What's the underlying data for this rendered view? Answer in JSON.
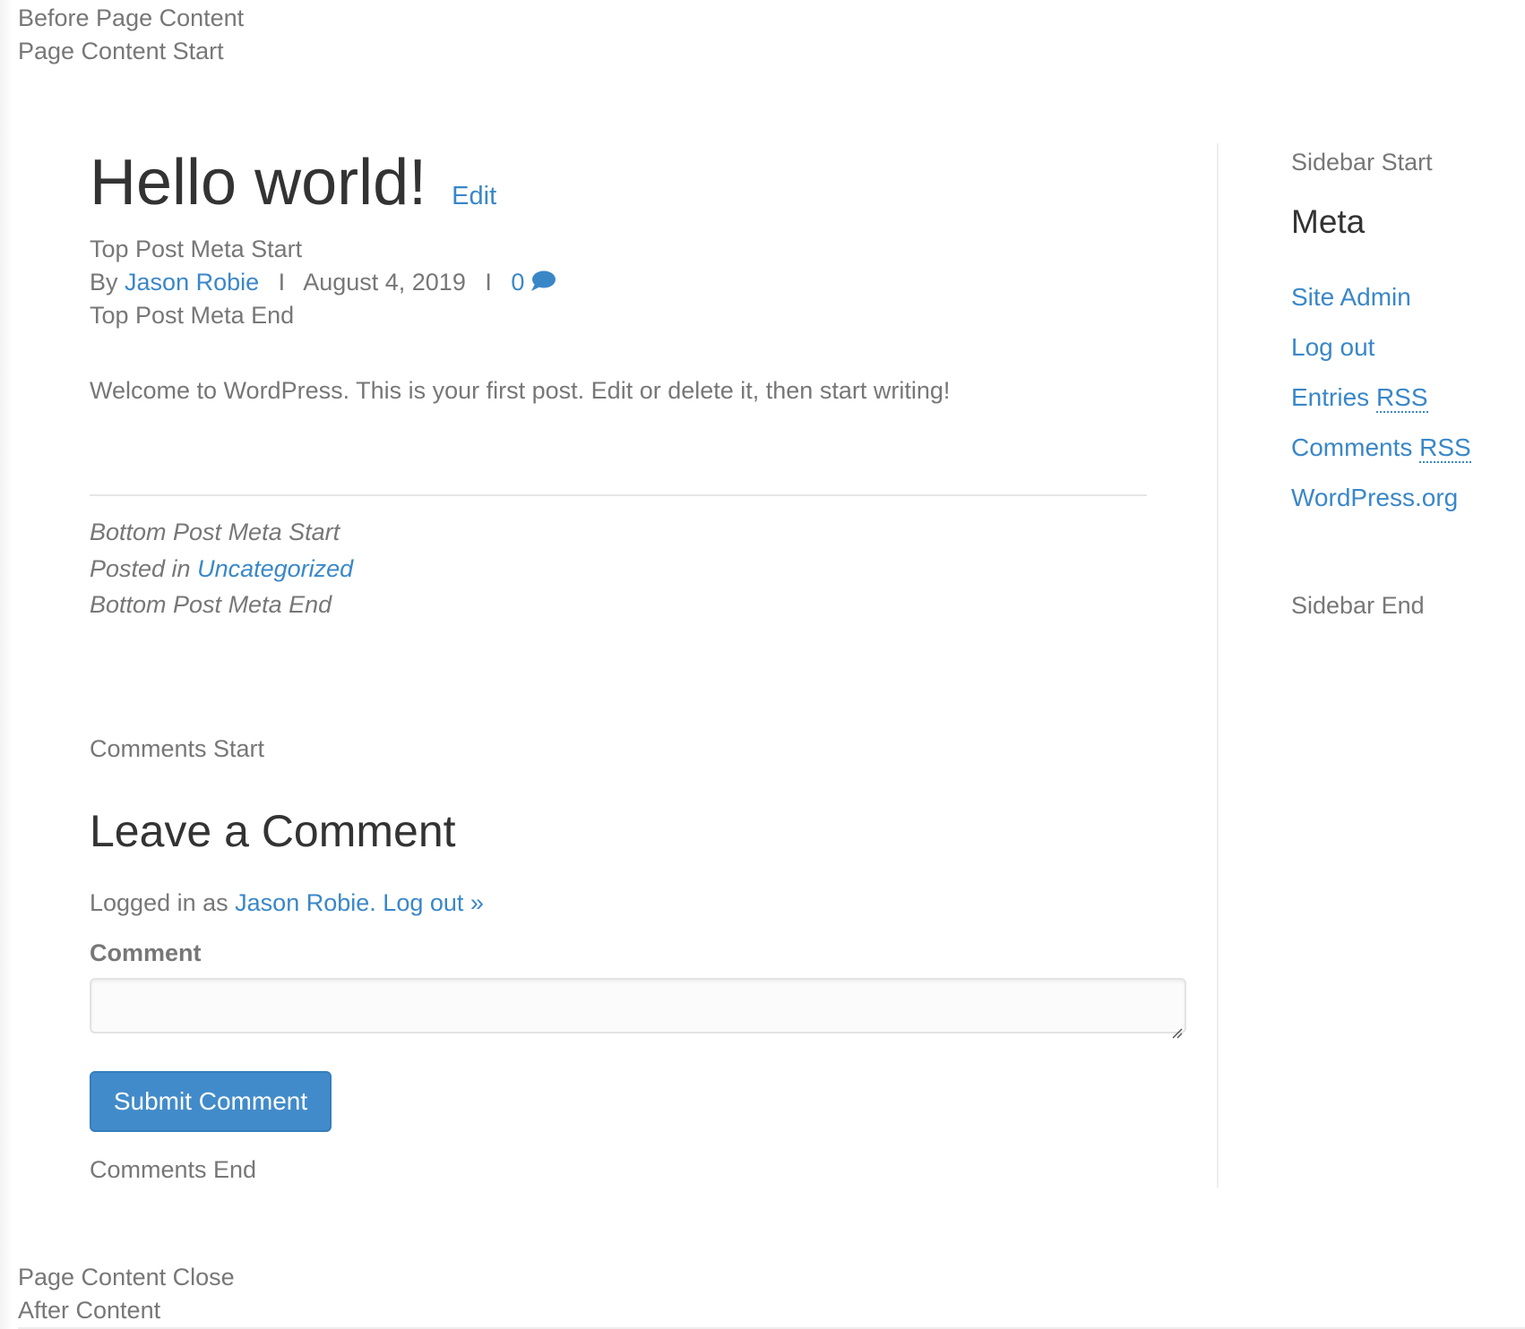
{
  "markers": {
    "before_page_content": "Before Page Content",
    "page_content_start": "Page Content Start",
    "page_content_close": "Page Content Close",
    "after_content": "After Content"
  },
  "post": {
    "title": "Hello world!",
    "edit_link": "Edit",
    "top_meta_start": "Top Post Meta Start",
    "by_label": "By",
    "author": "Jason Robie",
    "separator": "I",
    "date": "August 4, 2019",
    "comment_count": "0",
    "comment_icon": "speech-bubble-icon",
    "top_meta_end": "Top Post Meta End",
    "body": "Welcome to WordPress. This is your first post. Edit or delete it, then start writing!",
    "bottom_meta_start": "Bottom Post Meta Start",
    "posted_in_label": "Posted in",
    "category": "Uncategorized",
    "bottom_meta_end": "Bottom Post Meta End"
  },
  "comments": {
    "start_marker": "Comments Start",
    "heading": "Leave a Comment",
    "logged_in_prefix": "Logged in as",
    "logged_in_user": "Jason Robie",
    "logout_link": "Log out »",
    "field_label": "Comment",
    "field_value": "",
    "submit_label": "Submit Comment",
    "end_marker": "Comments End"
  },
  "sidebar": {
    "start_marker": "Sidebar Start",
    "widget_title": "Meta",
    "links": {
      "site_admin": "Site Admin",
      "log_out": "Log out",
      "entries_prefix": "Entries",
      "comments_prefix": "Comments",
      "rss_abbr": "RSS",
      "wordpress_org": "WordPress.org"
    },
    "end_marker": "Sidebar End"
  },
  "colors": {
    "link": "#3a87c8",
    "text": "#777777",
    "heading": "#333333",
    "button": "#428bca"
  }
}
